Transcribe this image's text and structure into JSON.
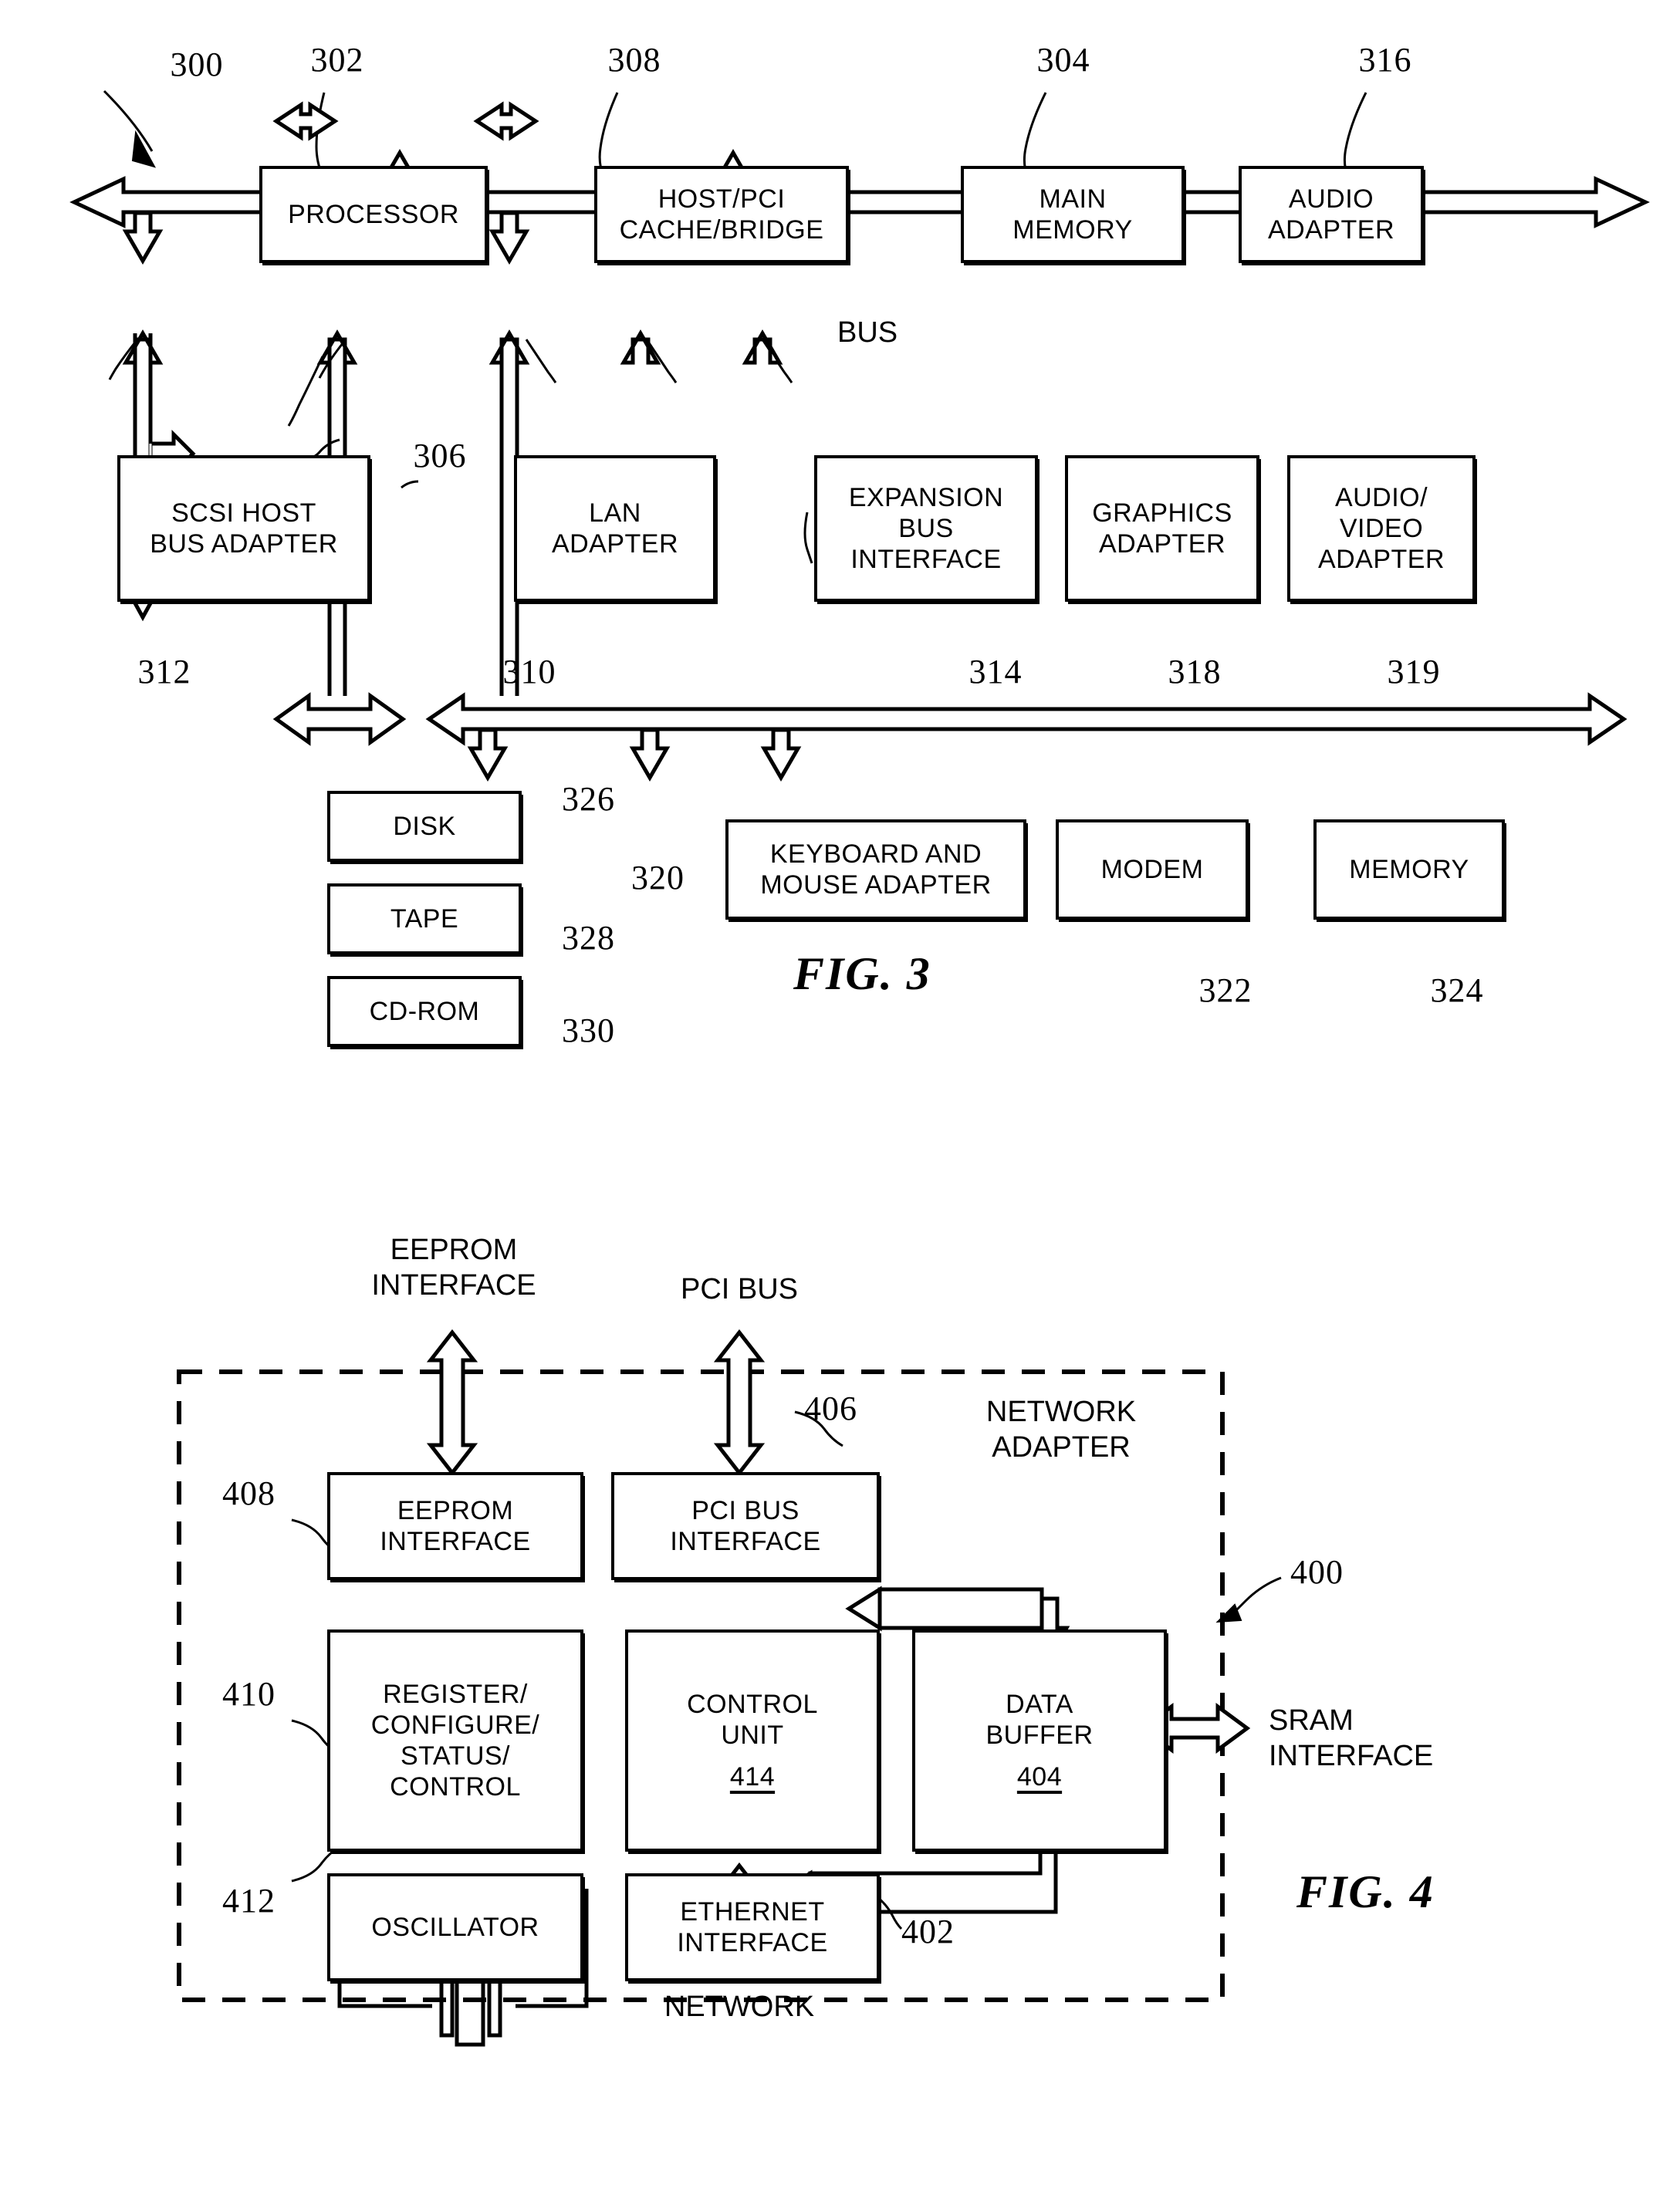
{
  "document": {
    "type": "patent-drawing-sheet",
    "figures": [
      "FIG. 3",
      "FIG. 4"
    ]
  },
  "fig3": {
    "label": "FIG. 3",
    "system_ref": "300",
    "bus_label": "BUS",
    "boxes": {
      "processor": {
        "lines": [
          "PROCESSOR"
        ],
        "ref": "302"
      },
      "host_bridge": {
        "lines": [
          "HOST/PCI",
          "CACHE/BRIDGE"
        ],
        "ref": "308"
      },
      "main_memory": {
        "lines": [
          "MAIN",
          "MEMORY"
        ],
        "ref": "304"
      },
      "audio_adapter": {
        "lines": [
          "AUDIO",
          "ADAPTER"
        ],
        "ref": "316"
      },
      "scsi_host_bus_adapter": {
        "lines": [
          "SCSI HOST",
          "BUS ADAPTER"
        ],
        "ref": "312"
      },
      "lan_adapter": {
        "lines": [
          "LAN",
          "ADAPTER"
        ],
        "ref": "310"
      },
      "expansion_bus_interface": {
        "lines": [
          "EXPANSION",
          "BUS",
          "INTERFACE"
        ],
        "ref": "314"
      },
      "graphics_adapter": {
        "lines": [
          "GRAPHICS",
          "ADAPTER"
        ],
        "ref": "318"
      },
      "audio_video_adapter": {
        "lines": [
          "AUDIO/",
          "VIDEO",
          "ADAPTER"
        ],
        "ref": "319"
      },
      "disk": {
        "lines": [
          "DISK"
        ],
        "ref": "326"
      },
      "tape": {
        "lines": [
          "TAPE"
        ],
        "ref": "328"
      },
      "cdrom": {
        "lines": [
          "CD-ROM"
        ],
        "ref": "330"
      },
      "keyboard_mouse_adapter": {
        "lines": [
          "KEYBOARD AND",
          "MOUSE ADAPTER"
        ],
        "ref": "320"
      },
      "modem": {
        "lines": [
          "MODEM"
        ],
        "ref": "322"
      },
      "memory": {
        "lines": [
          "MEMORY"
        ],
        "ref": "324"
      }
    },
    "bus_ref": "306"
  },
  "fig4": {
    "label": "FIG. 4",
    "enclosure_label": {
      "lines": [
        "NETWORK",
        "ADAPTER"
      ],
      "ref": "400"
    },
    "external_ports": {
      "eeprom_interface": [
        "EEPROM",
        "INTERFACE"
      ],
      "pci_bus": [
        "PCI BUS"
      ],
      "sram_interface": [
        "SRAM",
        "INTERFACE"
      ],
      "network": [
        "NETWORK"
      ]
    },
    "boxes": {
      "eeprom_interface": {
        "lines": [
          "EEPROM",
          "INTERFACE"
        ],
        "ref": "408"
      },
      "pci_bus_interface": {
        "lines": [
          "PCI BUS",
          "INTERFACE"
        ],
        "ref": "406"
      },
      "register_block": {
        "lines": [
          "REGISTER/",
          "CONFIGURE/",
          "STATUS/",
          "CONTROL"
        ],
        "ref": "410"
      },
      "control_unit": {
        "lines": [
          "CONTROL",
          "UNIT"
        ],
        "inner_ref": "414"
      },
      "data_buffer": {
        "lines": [
          "DATA",
          "BUFFER"
        ],
        "inner_ref": "404"
      },
      "oscillator": {
        "lines": [
          "OSCILLATOR"
        ],
        "ref": "412"
      },
      "ethernet_interface": {
        "lines": [
          "ETHERNET",
          "INTERFACE"
        ],
        "ref": "402"
      }
    }
  },
  "colors": {
    "ink": "#000000",
    "paper": "#ffffff"
  }
}
